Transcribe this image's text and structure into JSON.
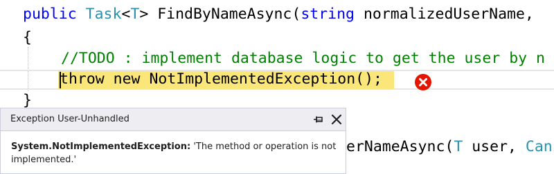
{
  "code": {
    "line1": {
      "kw_public": "public",
      "type_task": "Task",
      "generic_open": "<",
      "type_t": "T",
      "generic_close": ">",
      "method": " FindByNameAsync(",
      "kw_string": "string",
      "param": " normalizedUserName,"
    },
    "line2": {
      "brace_open": "{"
    },
    "line3": {
      "comment": "//TODO : implement database logic to get the user by n"
    },
    "line4": {
      "statement": "throw new NotImplementedException();"
    },
    "line5": {
      "brace_close": "}"
    },
    "line6": {
      "text": "erNameAsync(",
      "type_t": "T",
      "param": " user, ",
      "type_cancel": "Can"
    }
  },
  "exception_popup": {
    "title": "Exception User-Unhandled",
    "exception_type": "System.NotImplementedException:",
    "message": " 'The method or operation is not implemented.'",
    "pin_icon": "pin-icon",
    "close_icon": "close-icon"
  },
  "colors": {
    "keyword": "#0000ff",
    "type": "#2b91af",
    "comment": "#008000",
    "exec_highlight": "#fbe67a",
    "error": "#e51400"
  }
}
